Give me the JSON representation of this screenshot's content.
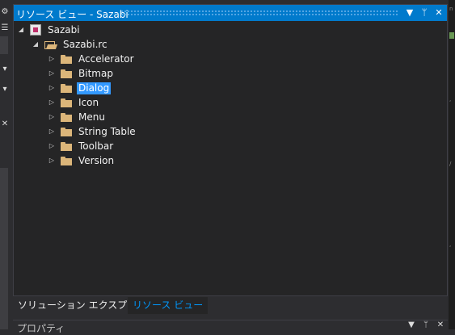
{
  "window": {
    "title": "リソース ビュー - Sazabi",
    "buttons": {
      "dropdown": "▼",
      "pin": "ᛘ",
      "close": "✕"
    }
  },
  "tree": {
    "root": {
      "label": "Sazabi",
      "expanded": true,
      "icon": "project-icon"
    },
    "rc_file": {
      "label": "Sazabi.rc",
      "expanded": true,
      "icon": "open-folder-icon"
    },
    "folders": [
      {
        "label": "Accelerator",
        "selected": false
      },
      {
        "label": "Bitmap",
        "selected": false
      },
      {
        "label": "Dialog",
        "selected": true
      },
      {
        "label": "Icon",
        "selected": false
      },
      {
        "label": "Menu",
        "selected": false
      },
      {
        "label": "String Table",
        "selected": false
      },
      {
        "label": "Toolbar",
        "selected": false
      },
      {
        "label": "Version",
        "selected": false
      }
    ]
  },
  "tabs": [
    {
      "label": "ソリューション エクスプローラー",
      "active": false
    },
    {
      "label": "リソース ビュー",
      "active": true
    }
  ],
  "bottom_panel": {
    "title": "プロパティ"
  },
  "colors": {
    "accent": "#007acc",
    "selection": "#3399ff",
    "active_tab": "#0097fb",
    "folder": "#dcb67a"
  }
}
